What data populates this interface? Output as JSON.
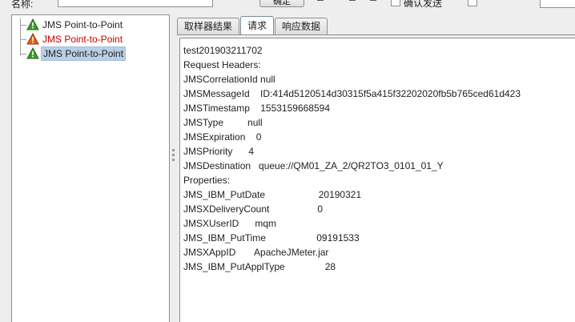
{
  "toolbar": {
    "filter_label": "名称:",
    "button_label": "确定",
    "check_label": "确认发送"
  },
  "tree": {
    "items": [
      {
        "label": "JMS Point-to-Point",
        "status": "success"
      },
      {
        "label": "JMS Point-to-Point",
        "status": "failure"
      },
      {
        "label": "JMS Point-to-Point",
        "status": "success"
      }
    ]
  },
  "tabs": [
    {
      "label": "取样器结果"
    },
    {
      "label": "请求"
    },
    {
      "label": "响应数据"
    }
  ],
  "request": {
    "lines": [
      "test201903211702",
      "Request Headers:",
      "JMSCorrelationId null",
      "JMSMessageId    ID:414d5120514d30315f5a415f32202020fb5b765ced61d423",
      "JMSTimestamp    1553159668594",
      "JMSType         null",
      "JMSExpiration    0",
      "JMSPriority      4",
      "JMSDestination   queue://QM01_ZA_2/QR2TO3_0101_01_Y",
      "Properties:",
      "JMS_IBM_PutDate                    20190321",
      "JMSXDeliveryCount                  0",
      "JMSXUserID      mqm",
      "JMS_IBM_PutTime                   09191533",
      "JMSXAppID       ApacheJMeter.jar",
      "JMS_IBM_PutApplType               28"
    ]
  },
  "colors": {
    "failure_text": "#cc0000",
    "selection_bg": "#b8cfe5",
    "success_icon": "#3a9a2a",
    "failure_icon": "#e06010"
  },
  "icons": {
    "success": "success-warning-triangle-icon",
    "failure": "failure-warning-triangle-icon"
  }
}
